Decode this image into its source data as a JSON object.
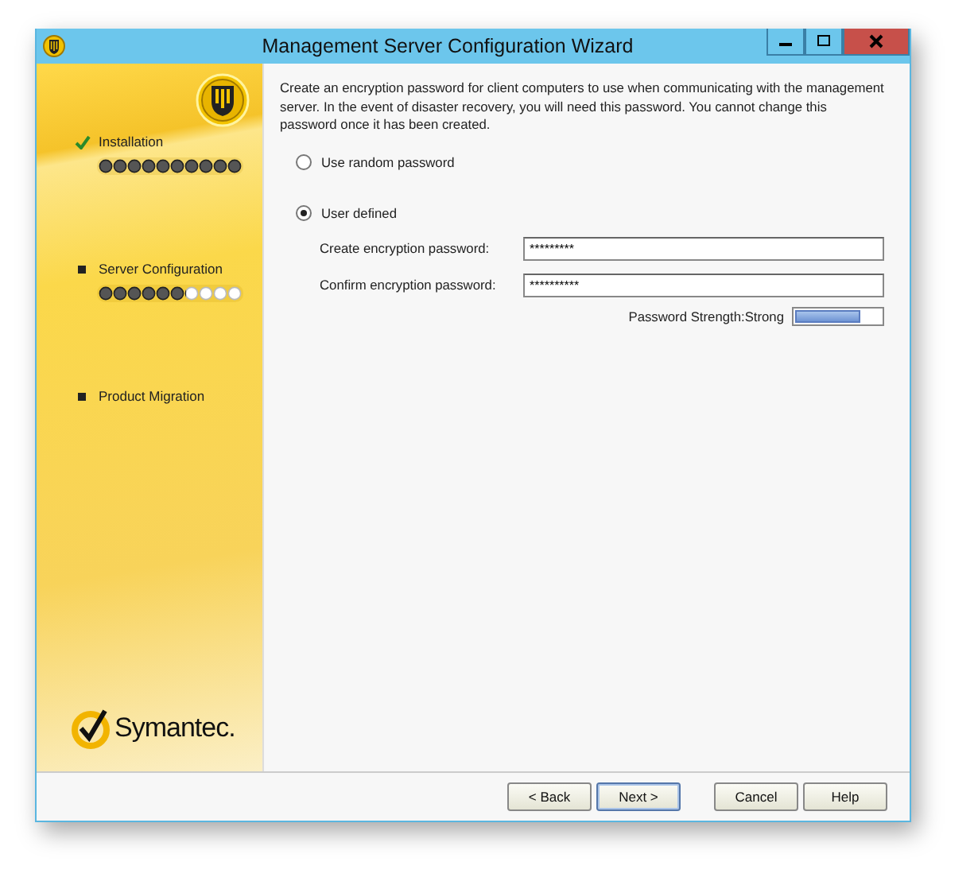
{
  "window": {
    "title": "Management Server Configuration Wizard"
  },
  "steps": [
    {
      "label": "Installation",
      "completed": true,
      "level": 1
    },
    {
      "label": "Server Configuration",
      "completed": false,
      "level": 0.6
    },
    {
      "label": "Product Migration",
      "completed": false
    }
  ],
  "brand": "Symantec.",
  "intro": "Create an encryption password for client computers to use when communicating with the management server. In the event of disaster recovery, you will need this password. You cannot change this password once it has been created.",
  "options": [
    {
      "label": "Use random password",
      "selected": false
    },
    {
      "label": "User defined",
      "selected": true
    }
  ],
  "fields": [
    {
      "label": "Create encryption password:",
      "value": "*********"
    },
    {
      "label": "Confirm encryption password:",
      "value": "**********"
    }
  ],
  "strength": {
    "label": "Password Strength:Strong",
    "level": 0.75
  },
  "buttons": [
    {
      "label": "< Back",
      "kind": "back"
    },
    {
      "label": "Next >",
      "kind": "default"
    },
    {
      "label": "Cancel",
      "kind": "cancel"
    },
    {
      "label": "Help",
      "kind": "help"
    }
  ]
}
